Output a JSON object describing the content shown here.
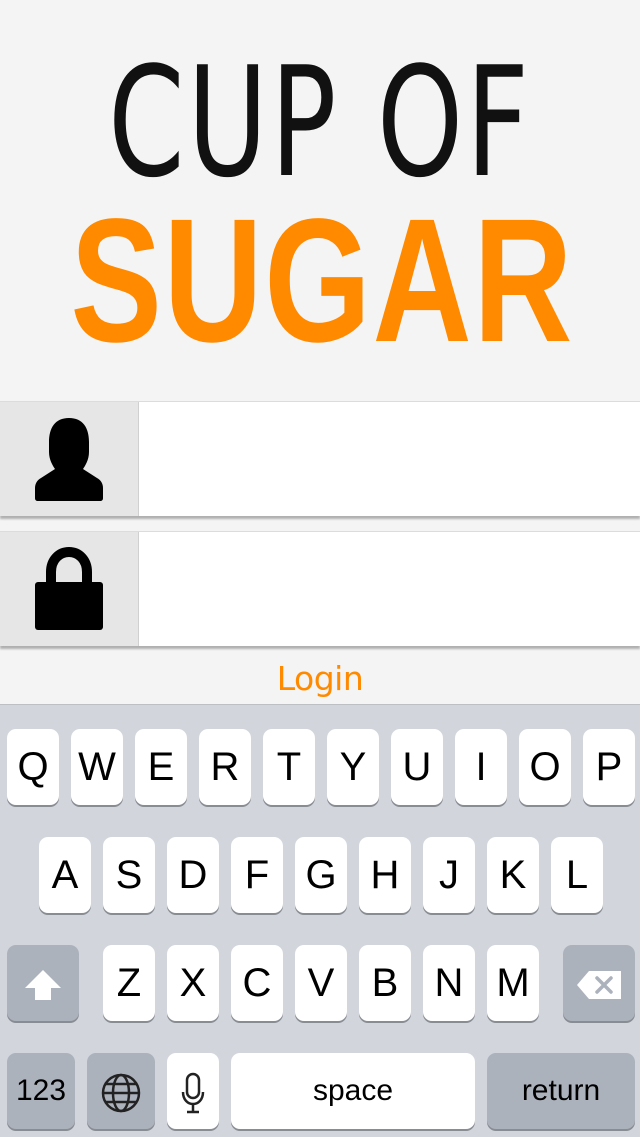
{
  "logo": {
    "line1": "CUP OF",
    "line2": "SUGAR",
    "accent_color": "#ff8a00"
  },
  "username_field": {
    "icon": "user-icon",
    "value": "",
    "placeholder": ""
  },
  "password_field": {
    "icon": "lock-icon",
    "value": "",
    "placeholder": ""
  },
  "login": {
    "label": "Login"
  },
  "keyboard": {
    "row1": [
      "Q",
      "W",
      "E",
      "R",
      "T",
      "Y",
      "U",
      "I",
      "O",
      "P"
    ],
    "row2": [
      "A",
      "S",
      "D",
      "F",
      "G",
      "H",
      "J",
      "K",
      "L"
    ],
    "row3": [
      "Z",
      "X",
      "C",
      "V",
      "B",
      "N",
      "M"
    ],
    "numbers_label": "123",
    "space_label": "space",
    "return_label": "return",
    "icons": {
      "shift": "shift-icon",
      "delete": "delete-icon",
      "globe": "globe-icon",
      "mic": "microphone-icon"
    }
  }
}
